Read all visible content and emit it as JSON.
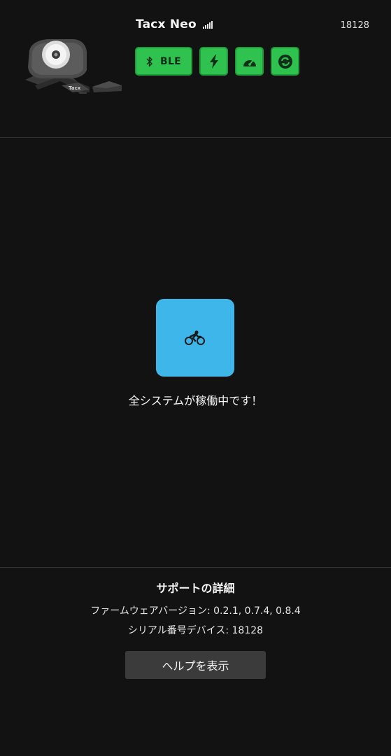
{
  "device": {
    "name": "Tacx Neo",
    "id": "18128",
    "image_icon": "smart-trainer-image",
    "signal_icon": "signal-strength-icon"
  },
  "connections": [
    {
      "icon": "bluetooth-icon",
      "label": "BLE"
    },
    {
      "icon": "power-bolt-icon",
      "label": ""
    },
    {
      "icon": "speedometer-icon",
      "label": ""
    },
    {
      "icon": "sync-icon",
      "label": ""
    }
  ],
  "colors": {
    "background": "#121212",
    "connected_green": "#2fc24e",
    "status_blue": "#3fb6ea",
    "help_button": "#3b3b3b"
  },
  "status": {
    "icon": "cyclist-icon",
    "message": "全システムが稼働中です！"
  },
  "support": {
    "title": "サポートの詳細",
    "firmware_line": "ファームウェアバージョン: 0.2.1, 0.7.4, 0.8.4",
    "serial_line": "シリアル番号デバイス: 18128",
    "help_button": "ヘルプを表示"
  }
}
